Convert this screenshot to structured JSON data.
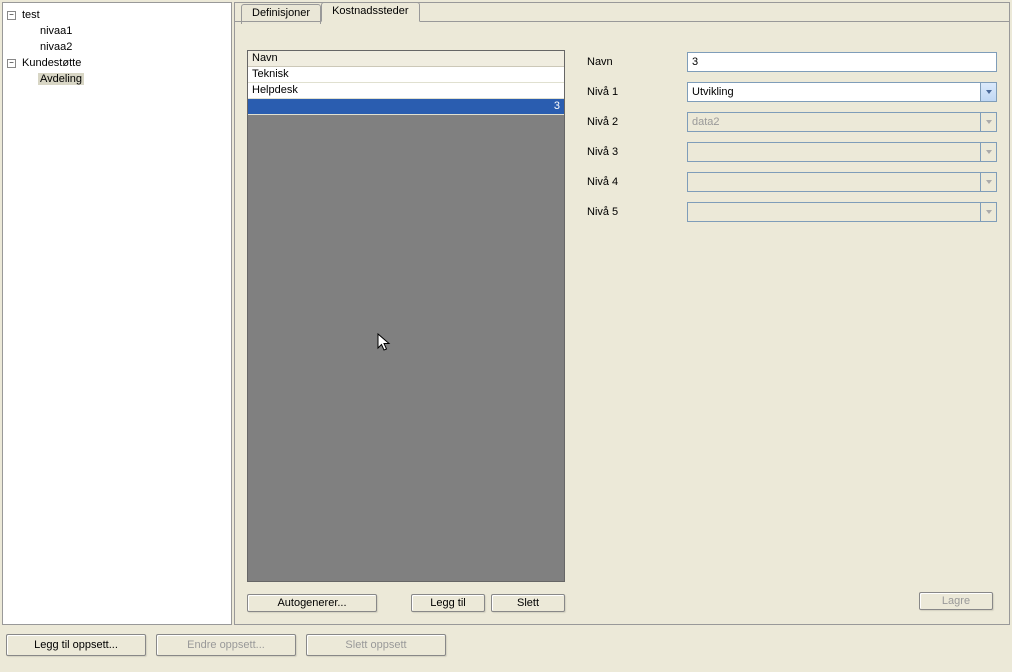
{
  "tree": {
    "root1": {
      "label": "test",
      "expanded": true
    },
    "root1_children": [
      {
        "label": "nivaa1"
      },
      {
        "label": "nivaa2"
      }
    ],
    "root2": {
      "label": "Kundestøtte",
      "expanded": true
    },
    "root2_children": [
      {
        "label": "Avdeling",
        "selected": true
      }
    ]
  },
  "tabs": {
    "definisjoner": "Definisjoner",
    "kostnadssteder": "Kostnadssteder"
  },
  "list": {
    "header": "Navn",
    "rows": [
      "Teknisk",
      "Helpdesk",
      "3"
    ]
  },
  "list_buttons": {
    "autogenerer": "Autogenerer...",
    "legg_til": "Legg til",
    "slett": "Slett"
  },
  "form": {
    "navn_label": "Navn",
    "navn_value": "3",
    "niva1_label": "Nivå 1",
    "niva1_value": "Utvikling",
    "niva2_label": "Nivå 2",
    "niva2_value": "data2",
    "niva3_label": "Nivå 3",
    "niva3_value": "",
    "niva4_label": "Nivå 4",
    "niva4_value": "",
    "niva5_label": "Nivå 5",
    "niva5_value": ""
  },
  "save_button": "Lagre",
  "bottom_buttons": {
    "legg_til_oppsett": "Legg til oppsett...",
    "endre_oppsett": "Endre oppsett...",
    "slett_oppsett": "Slett oppsett"
  }
}
